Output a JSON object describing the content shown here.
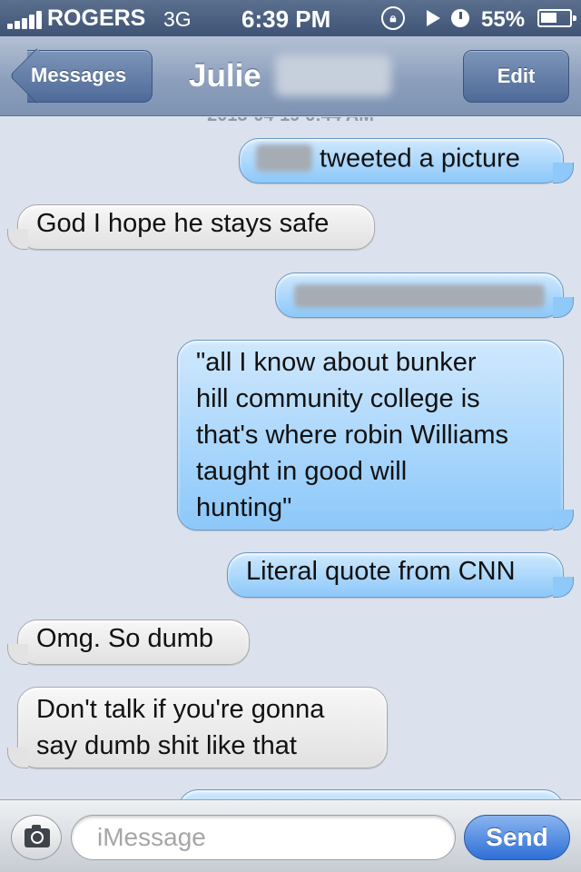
{
  "status_bar": {
    "carrier": "ROGERS",
    "network": "3G",
    "time": "6:39 PM",
    "battery": "55%",
    "battery_level": 0.55,
    "icons": [
      "signal-icon",
      "rotation-lock-icon",
      "play-icon",
      "alarm-icon",
      "battery-icon"
    ]
  },
  "nav": {
    "back_label": "Messages",
    "title": "Julie",
    "edit_label": "Edit"
  },
  "messages": [
    {
      "sender": "me",
      "text": "tweeted a picture",
      "redacted_prefix": true
    },
    {
      "sender": "them",
      "text": "God I hope he stays safe"
    },
    {
      "sender": "me",
      "text": "",
      "redacted": true
    },
    {
      "sender": "me",
      "lines": [
        "\"all I know about bunker",
        "hill community college is",
        "that's where robin Williams",
        "taught in good will",
        "hunting\""
      ]
    },
    {
      "sender": "me",
      "text": "Literal quote from CNN"
    },
    {
      "sender": "them",
      "text": "Omg. So dumb"
    },
    {
      "sender": "them",
      "lines": [
        "Don't talk if you're gonna",
        "say dumb shit like that"
      ]
    }
  ],
  "composer": {
    "placeholder": "iMessage",
    "send_label": "Send"
  },
  "colors": {
    "incoming_bubble": "#e6e6e6",
    "outgoing_bubble": "#a9d6fb",
    "background": "#dbe2ed",
    "nav_bar": "#8c9fbc",
    "send_button": "#2e6fd6"
  }
}
